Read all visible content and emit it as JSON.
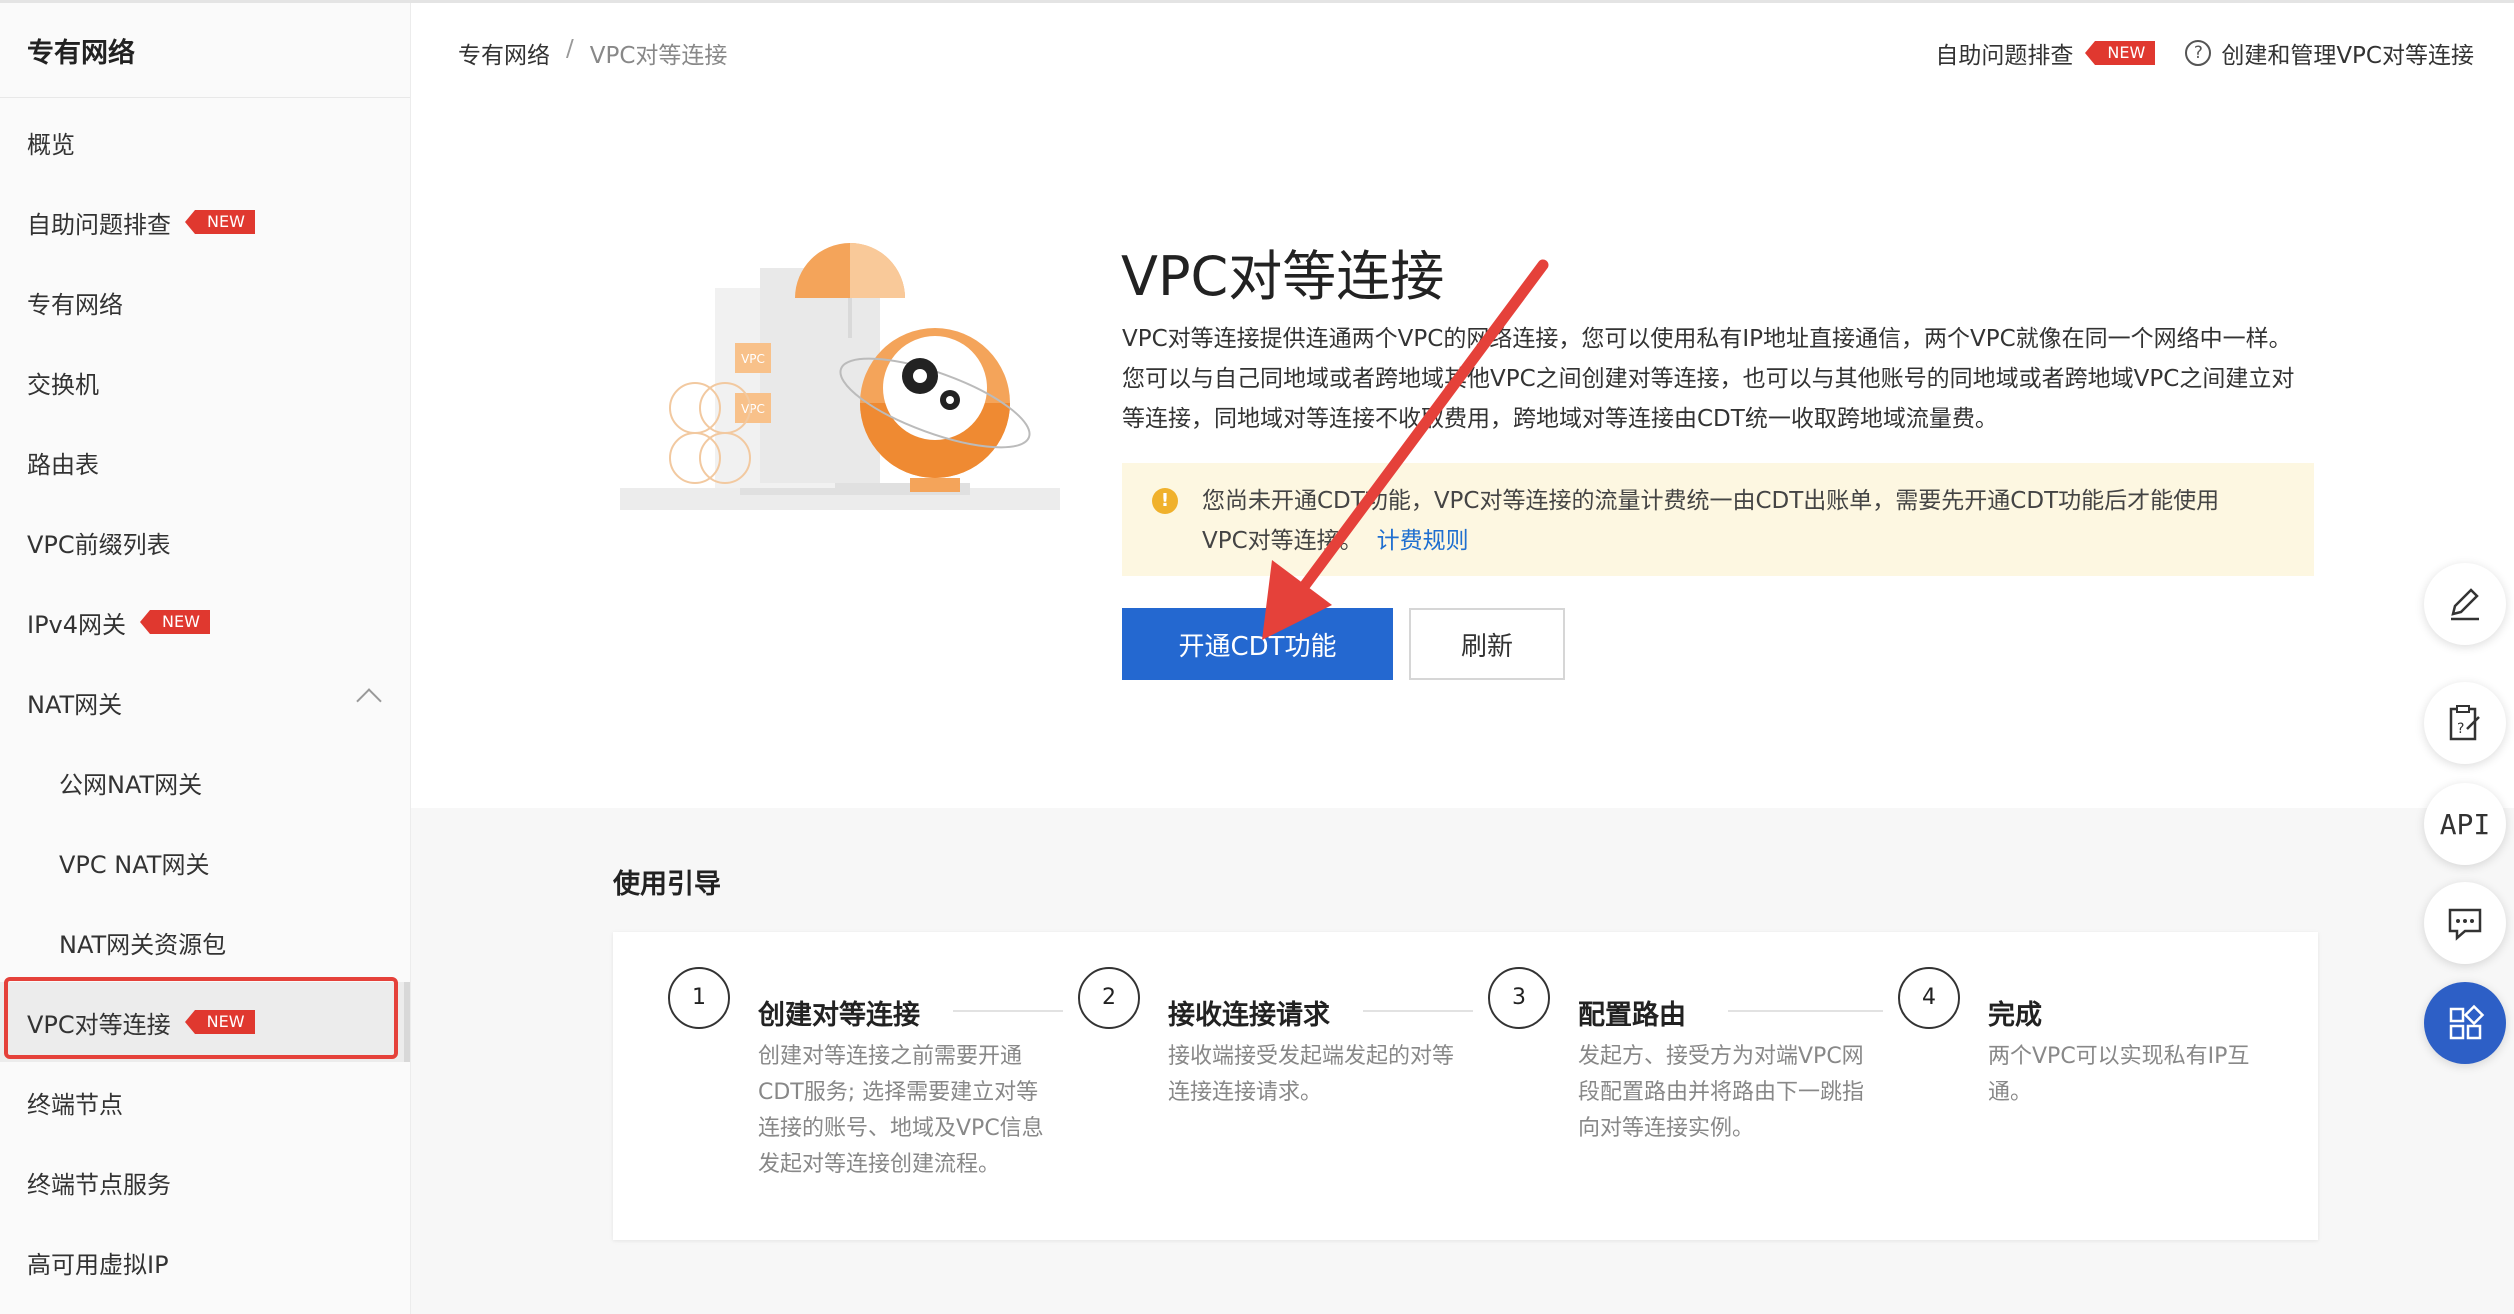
{
  "sidebar": {
    "title": "专有网络",
    "items": [
      {
        "label": "概览",
        "badge": ""
      },
      {
        "label": "自助问题排查",
        "badge": "NEW"
      },
      {
        "label": "专有网络",
        "badge": ""
      },
      {
        "label": "交换机",
        "badge": ""
      },
      {
        "label": "路由表",
        "badge": ""
      },
      {
        "label": "VPC前缀列表",
        "badge": ""
      },
      {
        "label": "IPv4网关",
        "badge": "NEW"
      },
      {
        "label": "NAT网关",
        "badge": "",
        "expanded": true
      },
      {
        "label": "公网NAT网关",
        "badge": "",
        "sub": true
      },
      {
        "label": "VPC NAT网关",
        "badge": "",
        "sub": true
      },
      {
        "label": "NAT网关资源包",
        "badge": "",
        "sub": true
      },
      {
        "label": "VPC对等连接",
        "badge": "NEW",
        "active": true
      },
      {
        "label": "终端节点",
        "badge": ""
      },
      {
        "label": "终端节点服务",
        "badge": ""
      },
      {
        "label": "高可用虚拟IP",
        "badge": ""
      }
    ]
  },
  "breadcrumb": {
    "root": "专有网络",
    "separator": "/",
    "current": "VPC对等连接"
  },
  "header": {
    "self_check": "自助问题排查",
    "self_check_badge": "NEW",
    "help_icon_glyph": "?",
    "help_link": "创建和管理VPC对等连接"
  },
  "hero": {
    "illustration_labels": [
      "VPC",
      "VPC"
    ],
    "title": "VPC对等连接",
    "description": "VPC对等连接提供连通两个VPC的网络连接，您可以使用私有IP地址直接通信，两个VPC就像在同一个网络中一样。您可以与自己同地域或者跨地域其他VPC之间创建对等连接，也可以与其他账号的同地域或者跨地域VPC之间建立对等连接，同地域对等连接不收取费用，跨地域对等连接由CDT统一收取跨地域流量费。",
    "notice_text": "您尚未开通CDT功能，VPC对等连接的流量计费统一由CDT出账单，需要先开通CDT功能后才能使用VPC对等连接。",
    "notice_link": "计费规则",
    "warn_glyph": "!",
    "primary_button": "开通CDT功能",
    "refresh_button": "刷新"
  },
  "guide": {
    "title": "使用引导",
    "steps": [
      {
        "num": "1",
        "title": "创建对等连接",
        "desc": "创建对等连接之前需要开通CDT服务; 选择需要建立对等连接的账号、地域及VPC信息发起对等连接创建流程。"
      },
      {
        "num": "2",
        "title": "接收连接请求",
        "desc": "接收端接受发起端发起的对等连接连接请求。"
      },
      {
        "num": "3",
        "title": "配置路由",
        "desc": "发起方、接受方为对端VPC网段配置路由并将路由下一跳指向对等连接实例。"
      },
      {
        "num": "4",
        "title": "完成",
        "desc": "两个VPC可以实现私有IP互通。"
      }
    ]
  },
  "float_buttons": [
    {
      "icon": "edit-icon"
    },
    {
      "icon": "clipboard-icon"
    },
    {
      "icon": "api-icon",
      "label": "API"
    },
    {
      "icon": "chat-icon"
    },
    {
      "icon": "apps-icon"
    }
  ],
  "colors": {
    "primary": "#2468d0",
    "badge": "#e0382f",
    "annotation": "#e5413a",
    "notice_bg": "#fdf7e1",
    "warn": "#f0b12c",
    "illustration_orange": "#f4a45a"
  }
}
